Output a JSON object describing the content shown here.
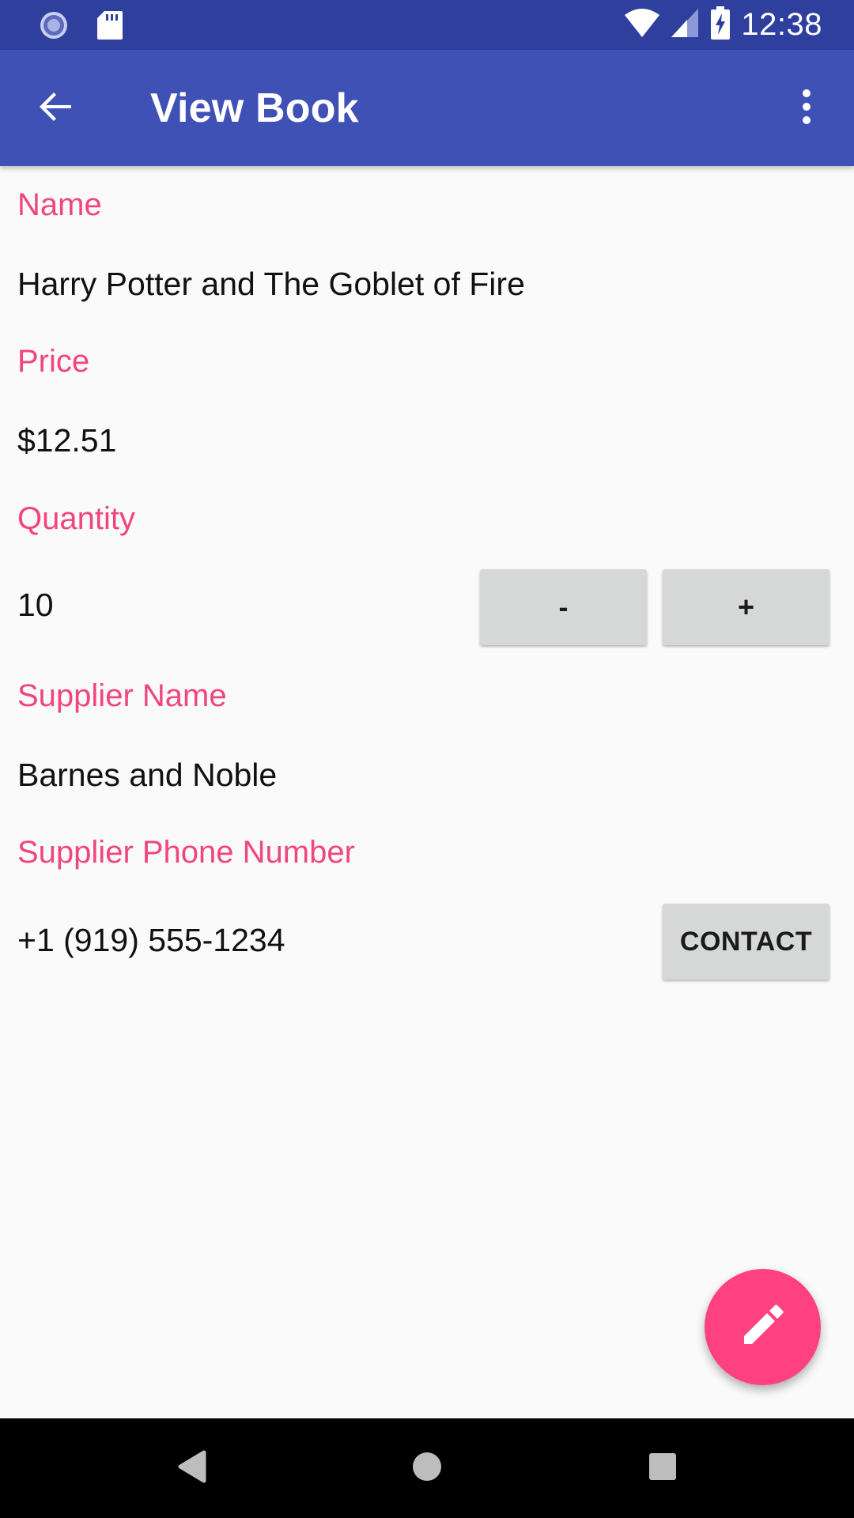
{
  "status_bar": {
    "time": "12:38",
    "left_icons": [
      "sync-icon",
      "sd-card-icon"
    ],
    "right_icons": [
      "wifi-icon",
      "signal-icon",
      "battery-charging-icon"
    ]
  },
  "app_bar": {
    "title": "View Book",
    "back_icon": "arrow-back-icon",
    "overflow_icon": "more-vert-icon"
  },
  "book": {
    "name_label": "Name",
    "name_value": "Harry Potter and The Goblet of Fire",
    "price_label": "Price",
    "price_value": "$12.51",
    "quantity_label": "Quantity",
    "quantity_value": "10",
    "decrement_label": "-",
    "increment_label": "+",
    "supplier_name_label": "Supplier Name",
    "supplier_name_value": "Barnes and Noble",
    "supplier_phone_label": "Supplier Phone Number",
    "supplier_phone_value": "+1 (919) 555-1234",
    "contact_label": "CONTACT"
  },
  "fab": {
    "icon": "edit-icon"
  },
  "nav_bar": {
    "icons": [
      "nav-back-icon",
      "nav-home-icon",
      "nav-recents-icon"
    ]
  },
  "colors": {
    "status_bar": "#2f3f9e",
    "app_bar": "#3f51b5",
    "label_accent": "#f0457f",
    "fab": "#ff4081",
    "button_bg": "#d6d7d7",
    "background": "#fafafa"
  }
}
